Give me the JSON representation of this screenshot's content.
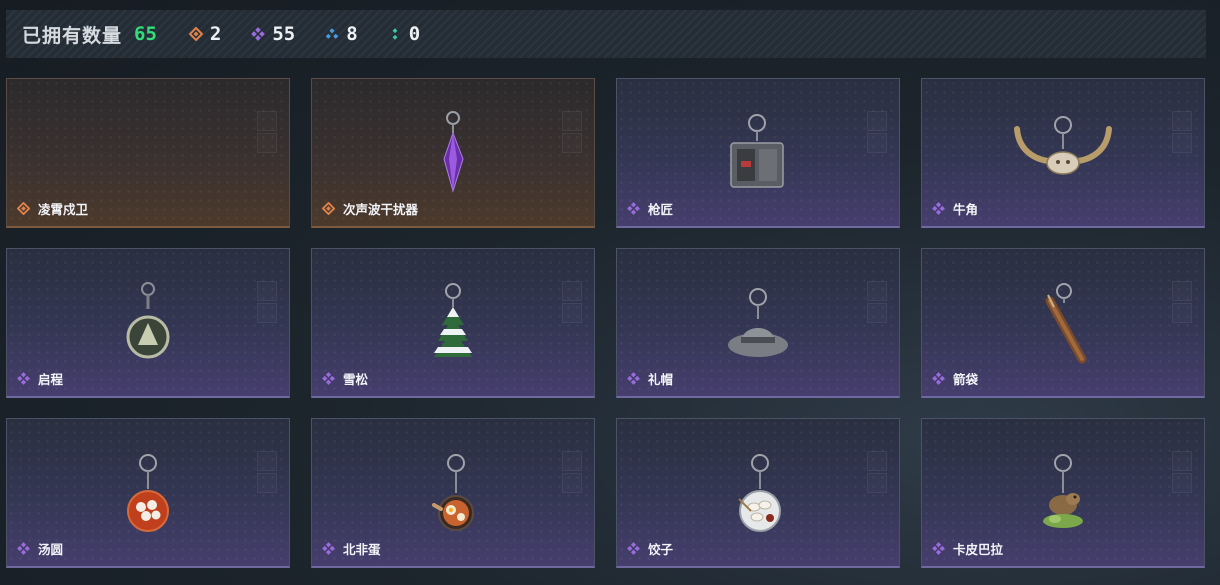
{
  "header": {
    "title": "已拥有数量",
    "total": "65",
    "stats": [
      {
        "icon": "orange-rarity-icon",
        "color": "#e0834a",
        "value": "2"
      },
      {
        "icon": "purple-rarity-icon",
        "color": "#9a6bdc",
        "value": "55"
      },
      {
        "icon": "blue-rarity-icon",
        "color": "#4a9ae0",
        "value": "8"
      },
      {
        "icon": "green-rarity-icon",
        "color": "#3ec9a0",
        "value": "0"
      }
    ]
  },
  "colors": {
    "orange": "#e0834a",
    "purple": "#9a6bdc",
    "total": "#2fe07a"
  },
  "items": [
    {
      "name": "凌霄戍卫",
      "rarity": "orange",
      "icon": "empty-icon"
    },
    {
      "name": "次声波干扰器",
      "rarity": "orange",
      "icon": "purple-crystal-pendant-icon"
    },
    {
      "name": "枪匠",
      "rarity": "purple",
      "icon": "gun-case-charm-icon"
    },
    {
      "name": "牛角",
      "rarity": "purple",
      "icon": "bull-horns-charm-icon"
    },
    {
      "name": "启程",
      "rarity": "purple",
      "icon": "medal-charm-icon"
    },
    {
      "name": "雪松",
      "rarity": "purple",
      "icon": "snow-pine-charm-icon"
    },
    {
      "name": "礼帽",
      "rarity": "purple",
      "icon": "fedora-hat-charm-icon"
    },
    {
      "name": "箭袋",
      "rarity": "purple",
      "icon": "quiver-charm-icon"
    },
    {
      "name": "汤圆",
      "rarity": "purple",
      "icon": "rice-ball-bowl-charm-icon"
    },
    {
      "name": "北非蛋",
      "rarity": "purple",
      "icon": "shakshuka-pan-charm-icon"
    },
    {
      "name": "饺子",
      "rarity": "purple",
      "icon": "dumpling-plate-charm-icon"
    },
    {
      "name": "卡皮巴拉",
      "rarity": "purple",
      "icon": "capybara-charm-icon"
    }
  ]
}
